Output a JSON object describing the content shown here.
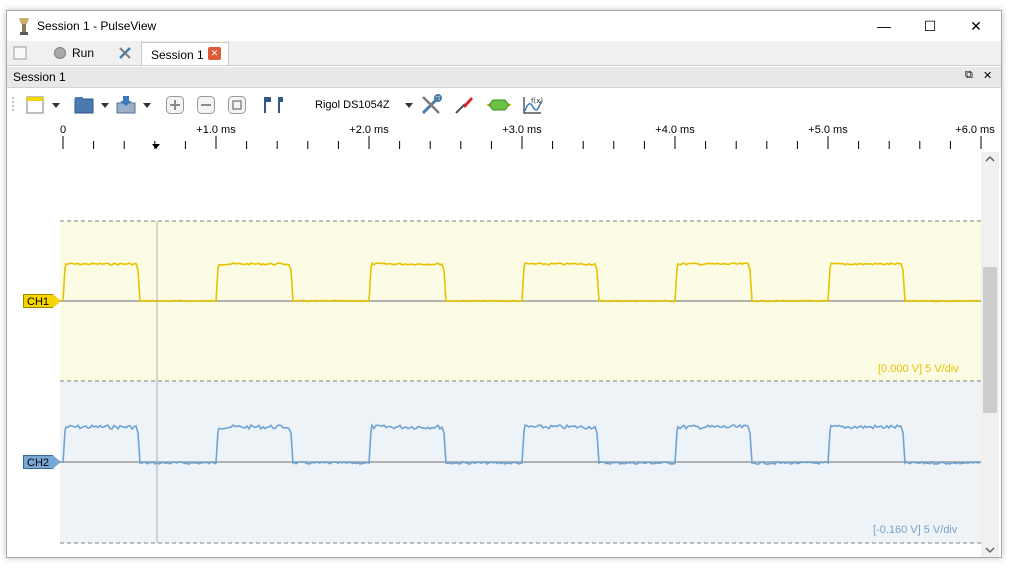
{
  "window": {
    "title": "Session 1 - PulseView",
    "minimize_glyph": "—",
    "maximize_glyph": "☐",
    "close_glyph": "✕"
  },
  "tabbar": {
    "run_label": "Run",
    "session_tab_label": "Session 1",
    "session_tab_close": "✕"
  },
  "dock": {
    "title": "Session 1",
    "float_glyph": "⧉",
    "close_glyph": "✕"
  },
  "toolbar": {
    "device_name": "Rigol DS1054Z"
  },
  "ruler": {
    "labels": [
      "0",
      "+1.0 ms",
      "+2.0 ms",
      "+3.0 ms",
      "+4.0 ms",
      "+5.0 ms",
      "+6.0 ms"
    ]
  },
  "channels": [
    {
      "name": "CH1",
      "scale": "[0.000 V] 5 V/div",
      "color": "#e6c300",
      "label_bg": "#f5d400",
      "band_bg": "#fcfbe4"
    },
    {
      "name": "CH2",
      "scale": "[-0.160 V] 5 V/div",
      "color": "#6fa3d2",
      "label_bg": "#7aa8d4",
      "band_bg": "#eef3f8"
    }
  ],
  "colors": {
    "accent": "#e05a3a",
    "separator": "#808080"
  }
}
